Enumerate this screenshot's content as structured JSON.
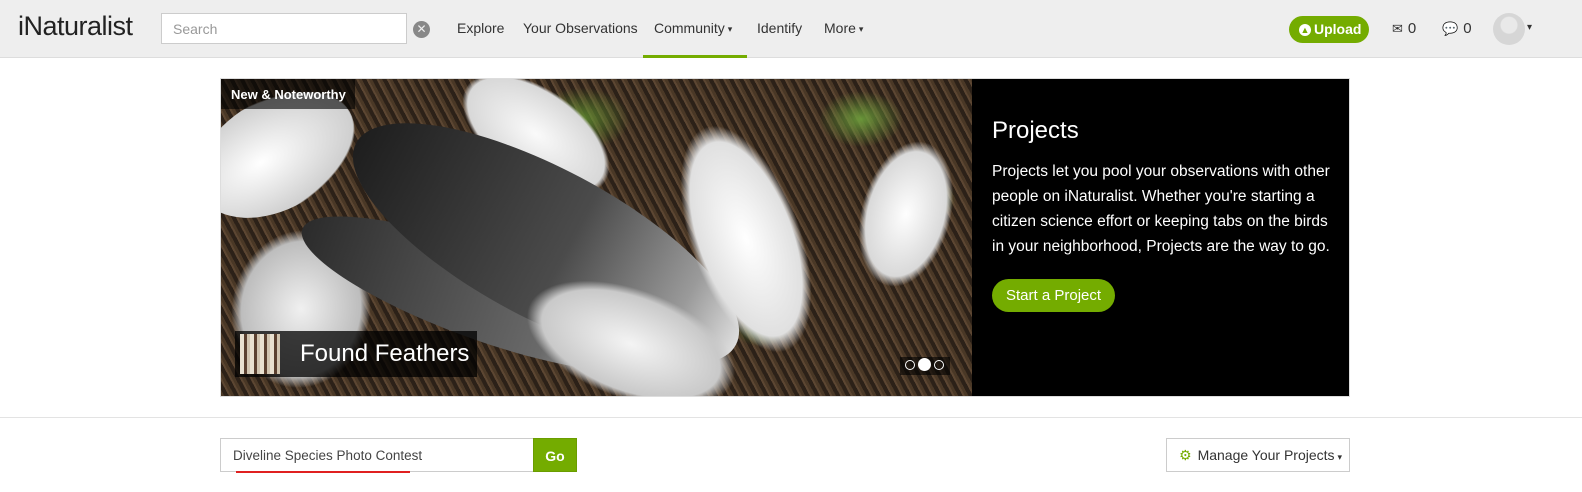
{
  "header": {
    "logo_text": "iNaturalist",
    "search_placeholder": "Search",
    "clear_icon": "times-circle-icon",
    "nav": [
      {
        "label": "Explore",
        "has_caret": false
      },
      {
        "label": "Your Observations",
        "has_caret": false
      },
      {
        "label": "Community",
        "has_caret": true,
        "active": true
      },
      {
        "label": "Identify",
        "has_caret": false
      },
      {
        "label": "More",
        "has_caret": true
      }
    ],
    "caret": "▾",
    "upload_label": "Upload",
    "upload_icon": "arrow-circle-up-icon",
    "messages_count": "0",
    "messages_icon": "envelope-icon",
    "notifications_count": "0",
    "notifications_icon": "comment-icon",
    "avatar": "user-avatar"
  },
  "hero": {
    "badge": "New & Noteworthy",
    "caption": "Found Feathers",
    "slides": 3,
    "active_slide": 2,
    "title": "Projects",
    "body": "Projects let you pool your observations with other people on iNaturalist. Whether you're starting a citizen science effort or keeping tabs on the birds in your neighborhood, Projects are the way to go.",
    "cta_label": "Start a Project"
  },
  "project_search": {
    "value": "Diveline Species Photo Contest",
    "go_label": "Go",
    "manage_label": "Manage Your Projects",
    "manage_icon": "gear-icon"
  },
  "colors": {
    "brand_green": "#74ac00",
    "header_bg": "#eeeeee",
    "hero_panel_bg": "#000000"
  }
}
